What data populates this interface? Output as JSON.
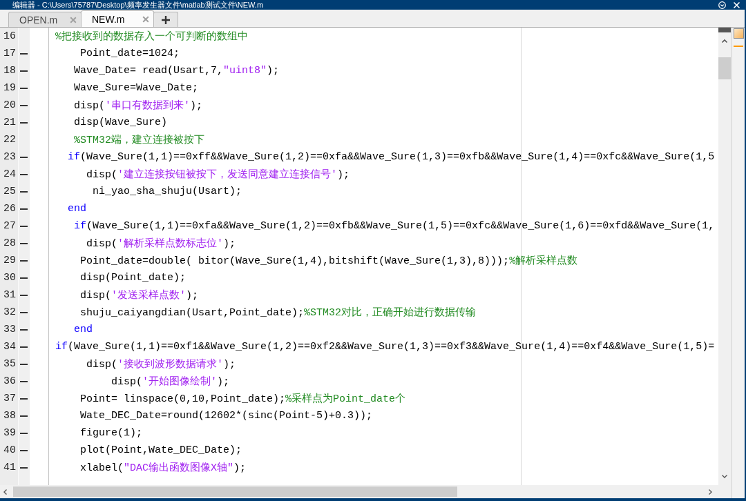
{
  "window": {
    "title": "编辑器 - C:\\Users\\75787\\Desktop\\频率发生器文件\\matlab测试文件\\NEW.m"
  },
  "tabs": [
    {
      "label": "OPEN.m",
      "selected": false
    },
    {
      "label": "NEW.m",
      "selected": true
    }
  ],
  "editor": {
    "lines": [
      {
        "number": "16",
        "executable": false,
        "segments": [
          {
            "kind": "comment",
            "text": "%把接收到的数据存入一个可判断的数组中"
          }
        ]
      },
      {
        "number": "17",
        "executable": true,
        "segments": [
          {
            "kind": "code",
            "text": "    Point_date=1024;"
          }
        ]
      },
      {
        "number": "18",
        "executable": true,
        "segments": [
          {
            "kind": "code",
            "text": "   Wave_Date= read(Usart,7,"
          },
          {
            "kind": "string",
            "text": "\"uint8\""
          },
          {
            "kind": "code",
            "text": ");"
          }
        ]
      },
      {
        "number": "19",
        "executable": true,
        "segments": [
          {
            "kind": "code",
            "text": "   Wave_Sure=Wave_Date;"
          }
        ]
      },
      {
        "number": "20",
        "executable": true,
        "segments": [
          {
            "kind": "code",
            "text": "   disp("
          },
          {
            "kind": "string",
            "text": "'串口有数据到来'"
          },
          {
            "kind": "code",
            "text": ");"
          }
        ]
      },
      {
        "number": "21",
        "executable": true,
        "segments": [
          {
            "kind": "code",
            "text": "   disp(Wave_Sure)"
          }
        ]
      },
      {
        "number": "22",
        "executable": false,
        "segments": [
          {
            "kind": "comment",
            "text": "   %STM32端，建立连接被按下"
          }
        ]
      },
      {
        "number": "23",
        "executable": true,
        "segments": [
          {
            "kind": "keyword",
            "text": "  if"
          },
          {
            "kind": "code",
            "text": "(Wave_Sure(1,1)==0xff&&Wave_Sure(1,2)==0xfa&&Wave_Sure(1,3)==0xfb&&Wave_Sure(1,4)==0xfc&&Wave_Sure(1,5"
          }
        ]
      },
      {
        "number": "24",
        "executable": true,
        "segments": [
          {
            "kind": "code",
            "text": "     disp("
          },
          {
            "kind": "string",
            "text": "'建立连接按钮被按下，发送同意建立连接信号'"
          },
          {
            "kind": "code",
            "text": ");"
          }
        ]
      },
      {
        "number": "25",
        "executable": true,
        "segments": [
          {
            "kind": "code",
            "text": "      ni_yao_sha_shuju(Usart);"
          }
        ]
      },
      {
        "number": "26",
        "executable": true,
        "segments": [
          {
            "kind": "keyword",
            "text": "  end"
          }
        ]
      },
      {
        "number": "27",
        "executable": true,
        "segments": [
          {
            "kind": "keyword",
            "text": "   if"
          },
          {
            "kind": "code",
            "text": "(Wave_Sure(1,1)==0xfa&&Wave_Sure(1,2)==0xfb&&Wave_Sure(1,5)==0xfc&&Wave_Sure(1,6)==0xfd&&Wave_Sure(1,"
          }
        ]
      },
      {
        "number": "28",
        "executable": true,
        "segments": [
          {
            "kind": "code",
            "text": "     disp("
          },
          {
            "kind": "string",
            "text": "'解析采样点数标志位'"
          },
          {
            "kind": "code",
            "text": ");"
          }
        ]
      },
      {
        "number": "29",
        "executable": true,
        "segments": [
          {
            "kind": "code",
            "text": "    Point_date=double( bitor(Wave_Sure(1,4),bitshift(Wave_Sure(1,3),8)));"
          },
          {
            "kind": "comment",
            "text": "%解析采样点数"
          }
        ]
      },
      {
        "number": "30",
        "executable": true,
        "segments": [
          {
            "kind": "code",
            "text": "    disp(Point_date);"
          }
        ]
      },
      {
        "number": "31",
        "executable": true,
        "segments": [
          {
            "kind": "code",
            "text": "    disp("
          },
          {
            "kind": "string",
            "text": "'发送采样点数'"
          },
          {
            "kind": "code",
            "text": ");"
          }
        ]
      },
      {
        "number": "32",
        "executable": true,
        "segments": [
          {
            "kind": "code",
            "text": "    shuju_caiyangdian(Usart,Point_date);"
          },
          {
            "kind": "comment",
            "text": "%STM32对比，正确开始进行数据传输"
          }
        ]
      },
      {
        "number": "33",
        "executable": true,
        "segments": [
          {
            "kind": "keyword",
            "text": "   end"
          }
        ]
      },
      {
        "number": "34",
        "executable": true,
        "segments": [
          {
            "kind": "keyword",
            "text": "if"
          },
          {
            "kind": "code",
            "text": "(Wave_Sure(1,1)==0xf1&&Wave_Sure(1,2)==0xf2&&Wave_Sure(1,3)==0xf3&&Wave_Sure(1,4)==0xf4&&Wave_Sure(1,5)="
          }
        ]
      },
      {
        "number": "35",
        "executable": true,
        "segments": [
          {
            "kind": "code",
            "text": "     disp("
          },
          {
            "kind": "string",
            "text": "'接收到波形数据请求'"
          },
          {
            "kind": "code",
            "text": ");"
          }
        ]
      },
      {
        "number": "36",
        "executable": true,
        "segments": [
          {
            "kind": "code",
            "text": "         disp("
          },
          {
            "kind": "string",
            "text": "'开始图像绘制'"
          },
          {
            "kind": "code",
            "text": ");"
          }
        ]
      },
      {
        "number": "37",
        "executable": true,
        "segments": [
          {
            "kind": "code",
            "text": "    Point= linspace(0,10,Point_date);"
          },
          {
            "kind": "comment",
            "text": "%采样点为Point_date个"
          }
        ]
      },
      {
        "number": "38",
        "executable": true,
        "segments": [
          {
            "kind": "code",
            "text": "    Wate_DEC_Date=round(12602*(sinc(Point-5)+0.3));"
          }
        ]
      },
      {
        "number": "39",
        "executable": true,
        "segments": [
          {
            "kind": "code",
            "text": "    figure(1);"
          }
        ]
      },
      {
        "number": "40",
        "executable": true,
        "segments": [
          {
            "kind": "code",
            "text": "    plot(Point,Wate_DEC_Date);"
          }
        ]
      },
      {
        "number": "41",
        "executable": true,
        "segments": [
          {
            "kind": "code",
            "text": "    xlabel("
          },
          {
            "kind": "string",
            "text": "\"DAC输出函数图像X轴\""
          },
          {
            "kind": "code",
            "text": ");"
          }
        ]
      }
    ]
  }
}
